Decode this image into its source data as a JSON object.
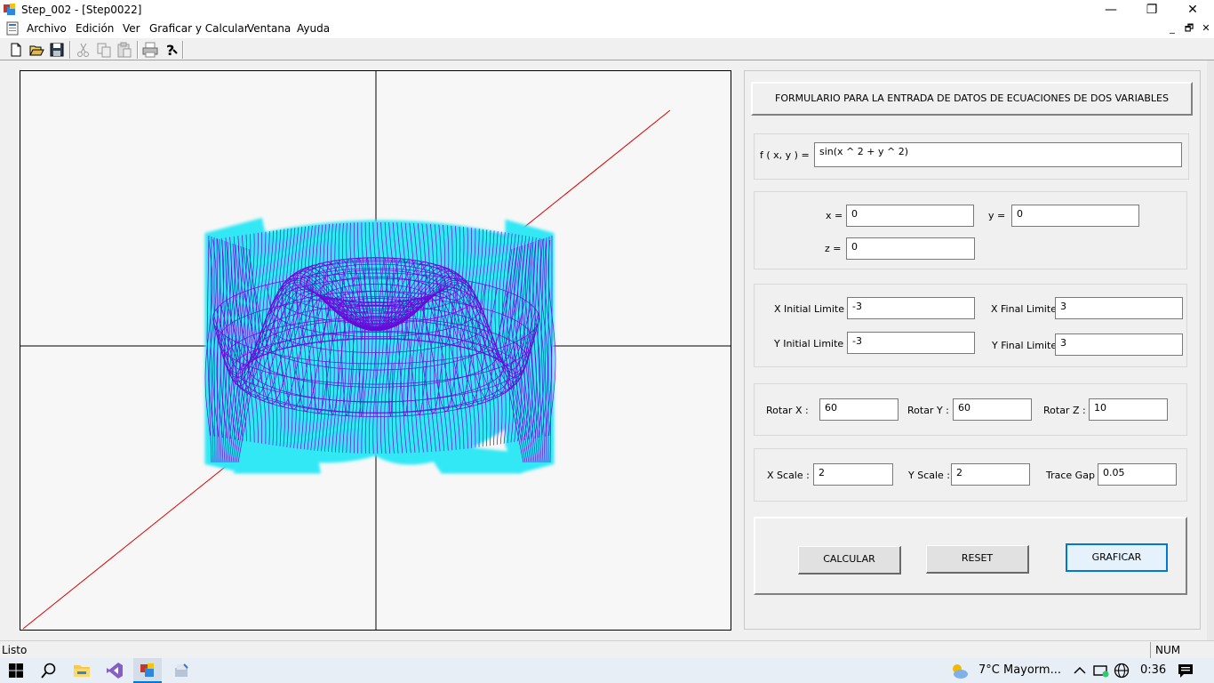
{
  "window": {
    "title": "Step_002 - [Step0022]",
    "minimize": "—",
    "maximize": "❐",
    "close": "✕"
  },
  "menu": {
    "items": [
      "Archivo",
      "Edición",
      "Ver",
      "Graficar y Calcular",
      "Ventana",
      "Ayuda"
    ],
    "mdi_minimize": "_",
    "mdi_restore": "🗗",
    "mdi_close": "✕"
  },
  "toolbar": {
    "buttons": [
      "new-icon",
      "open-icon",
      "save-icon",
      "cut-icon",
      "copy-icon",
      "paste-icon",
      "print-icon",
      "help-icon"
    ]
  },
  "panel": {
    "header": "FORMULARIO PARA LA ENTRADA DE DATOS DE ECUACIONES DE DOS VARIABLES",
    "function_label": "f ( x, y )  =",
    "function_value": "sin(x ^ 2 + y ^ 2)",
    "x_label": "x =",
    "x_value": "0",
    "y_label": "y =",
    "y_value": "0",
    "z_label": "z =",
    "z_value": "0",
    "x_initial_label": "X Initial Limite :",
    "x_initial_value": "-3",
    "x_final_label": "X Final Limite :",
    "x_final_value": "3",
    "y_initial_label": "Y Initial Limite :",
    "y_initial_value": "-3",
    "y_final_label": "Y Final Limite :",
    "y_final_value": "3",
    "rot_x_label": "Rotar X :",
    "rot_x_value": "60",
    "rot_y_label": "Rotar Y :",
    "rot_y_value": "60",
    "rot_z_label": "Rotar Z :",
    "rot_z_value": "10",
    "x_scale_label": "X Scale :",
    "x_scale_value": "2",
    "y_scale_label": "Y Scale :",
    "y_scale_value": "2",
    "trace_gap_label": "Trace Gap",
    "trace_gap_value": "0.05",
    "calcular_label": "CALCULAR",
    "reset_label": "RESET",
    "graficar_label": "GRAFICAR"
  },
  "status": {
    "text": "Listo",
    "num": "NUM"
  },
  "taskbar": {
    "weather": "7°C  Mayorm...",
    "time": "0:36"
  },
  "plot": {
    "axis_color": "#000000",
    "diagonal_color": "#dd0000",
    "surface_color": "#6a0ad8",
    "glow_color": "#33e8f5"
  }
}
